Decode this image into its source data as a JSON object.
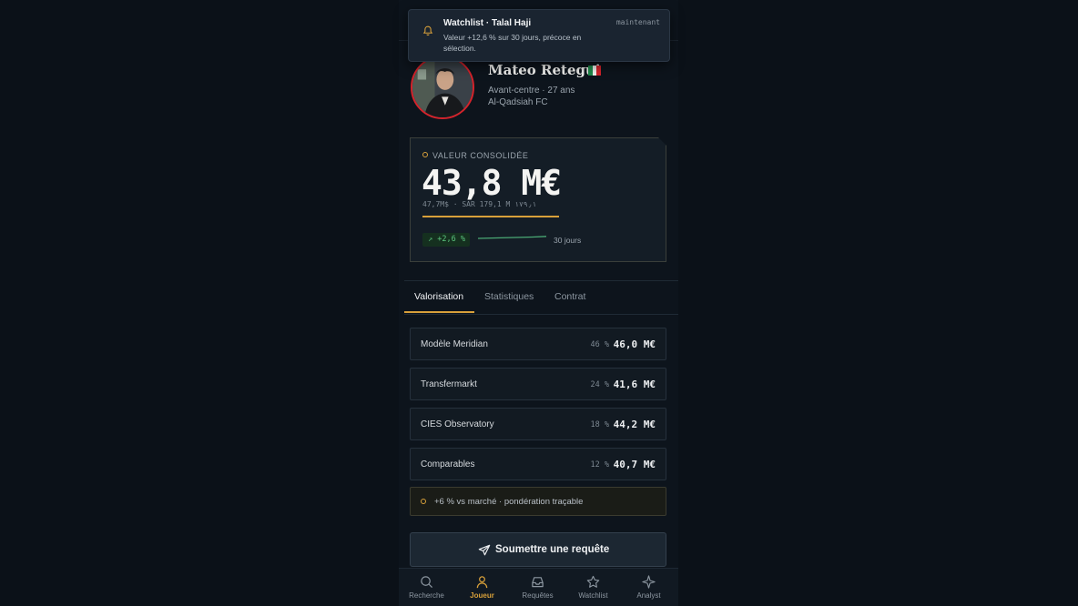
{
  "toast": {
    "title": "Watchlist · Talal Haji",
    "body": "Valeur +12,6 % sur 30 jours, précoce en sélection.",
    "time": "maintenant",
    "icon": "bell-icon"
  },
  "player": {
    "name": "Mateo Retegui",
    "flag_colors": [
      "#1f8a4c",
      "#f4f4f2",
      "#d5232b"
    ],
    "position_age": "Avant-centre · 27 ans",
    "club": "Al-Qadsiah FC"
  },
  "value_card": {
    "label": "VALEUR CONSOLIDÉE",
    "value": "43,8 M€",
    "sub": "47,7M$ · SAR 179,1 M ١٧٩٫١",
    "delta": "↗ +2,6 %",
    "period": "30 jours"
  },
  "tabs": [
    {
      "label": "Valorisation",
      "active": true
    },
    {
      "label": "Statistiques",
      "active": false
    },
    {
      "label": "Contrat",
      "active": false
    }
  ],
  "sources": [
    {
      "label": "Modèle Meridian",
      "weight": "46 %",
      "value": "46,0 M€"
    },
    {
      "label": "Transfermarkt",
      "weight": "24 %",
      "value": "41,6 M€"
    },
    {
      "label": "CIES Observatory",
      "weight": "18 %",
      "value": "44,2 M€"
    },
    {
      "label": "Comparables",
      "weight": "12 %",
      "value": "40,7 M€"
    }
  ],
  "note": "+6 % vs marché · pondération traçable",
  "submit": {
    "label": "Soumettre une requête",
    "icon": "send-icon"
  },
  "bottom_nav": [
    {
      "label": "Recherche",
      "icon": "search-icon",
      "active": false
    },
    {
      "label": "Joueur",
      "icon": "user-icon",
      "active": true
    },
    {
      "label": "Requêtes",
      "icon": "inbox-icon",
      "active": false
    },
    {
      "label": "Watchlist",
      "icon": "star-icon",
      "active": false
    },
    {
      "label": "Analyst",
      "icon": "sparkle-icon",
      "active": false
    }
  ],
  "colors": {
    "accent": "#d8a03a",
    "positive": "#5bc47e",
    "avatar_ring": "#d5232b"
  }
}
